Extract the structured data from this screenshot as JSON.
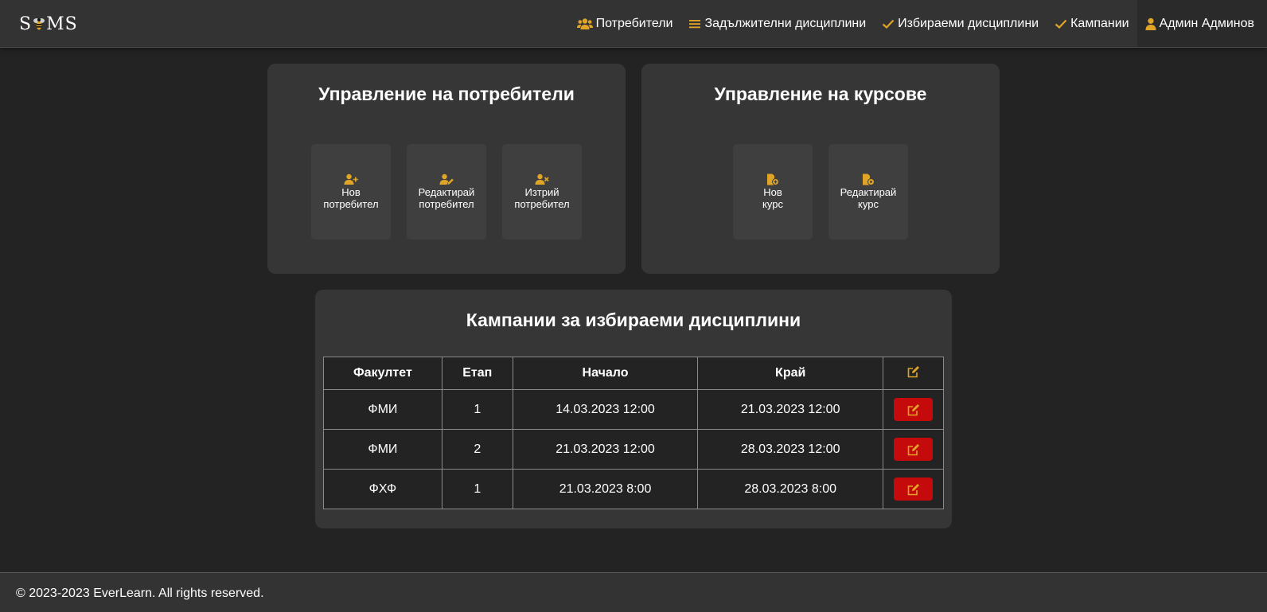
{
  "brand": {
    "logo_text_left": "S",
    "logo_text_right": "MS"
  },
  "nav": {
    "items": [
      {
        "label": "Потребители",
        "icon": "users-icon"
      },
      {
        "label": "Задължителни дисциплини",
        "icon": "list-icon"
      },
      {
        "label": "Избираеми дисциплини",
        "icon": "check-icon"
      },
      {
        "label": "Кампании",
        "icon": "check-icon"
      }
    ],
    "user": {
      "label": "Админ Админов",
      "icon": "user-icon"
    }
  },
  "users_panel": {
    "title": "Управление на потребители",
    "tiles": [
      {
        "line1": "Нов",
        "line2": "потребител",
        "icon": "user-plus-icon"
      },
      {
        "line1": "Редактирай",
        "line2": "потребител",
        "icon": "user-edit-icon"
      },
      {
        "line1": "Изтрий",
        "line2": "потребител",
        "icon": "user-remove-icon"
      }
    ]
  },
  "courses_panel": {
    "title": "Управление на курсове",
    "tiles": [
      {
        "line1": "Нов",
        "line2": "курс",
        "icon": "file-plus-icon"
      },
      {
        "line1": "Редактирай",
        "line2": "курс",
        "icon": "file-edit-icon"
      }
    ]
  },
  "campaigns_panel": {
    "title": "Кампании за избираеми дисциплини",
    "columns": [
      "Факултет",
      "Етап",
      "Начало",
      "Край"
    ],
    "rows": [
      {
        "faculty": "ФМИ",
        "stage": "1",
        "start": "14.03.2023 12:00",
        "end": "21.03.2023 12:00"
      },
      {
        "faculty": "ФМИ",
        "stage": "2",
        "start": "21.03.2023 12:00",
        "end": "28.03.2023 12:00"
      },
      {
        "faculty": "ФХФ",
        "stage": "1",
        "start": "21.03.2023 8:00",
        "end": "28.03.2023 8:00"
      }
    ]
  },
  "footer": {
    "text": "© 2023-2023 EverLearn. All rights reserved."
  },
  "colors": {
    "accent": "#e0a526",
    "danger": "#c40a0a",
    "background": "#232323",
    "card": "#363636",
    "navbar": "#333333"
  }
}
